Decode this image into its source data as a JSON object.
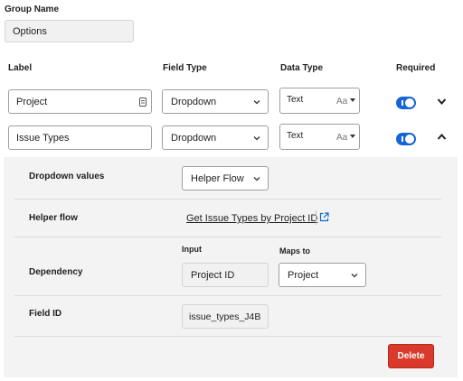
{
  "group": {
    "label": "Group Name",
    "value": "Options"
  },
  "columns": {
    "label": "Label",
    "field_type": "Field Type",
    "data_type": "Data Type",
    "required": "Required"
  },
  "fields": [
    {
      "label": "Project",
      "field_type": "Dropdown",
      "data_type": "Text",
      "data_type_glyph": "Aa",
      "required": true,
      "expanded": false
    },
    {
      "label": "Issue Types",
      "field_type": "Dropdown",
      "data_type": "Text",
      "data_type_glyph": "Aa",
      "required": true,
      "expanded": true
    }
  ],
  "details": {
    "dropdown_values": {
      "label": "Dropdown values",
      "value": "Helper Flow"
    },
    "helper_flow": {
      "label": "Helper flow",
      "link": "Get Issue Types by Project ID"
    },
    "dependency": {
      "label": "Dependency",
      "input_header": "Input",
      "maps_to_header": "Maps to",
      "input_value": "Project ID",
      "maps_to_value": "Project"
    },
    "field_id": {
      "label": "Field ID",
      "value": "issue_types_J4B"
    },
    "delete_label": "Delete"
  },
  "colors": {
    "toggle": "#1565d8",
    "delete": "#d93a2b",
    "panel": "#f3f3f3"
  },
  "icons": [
    "form-field-icon",
    "chevron-down-icon",
    "chevron-up-icon",
    "external-link-icon"
  ]
}
